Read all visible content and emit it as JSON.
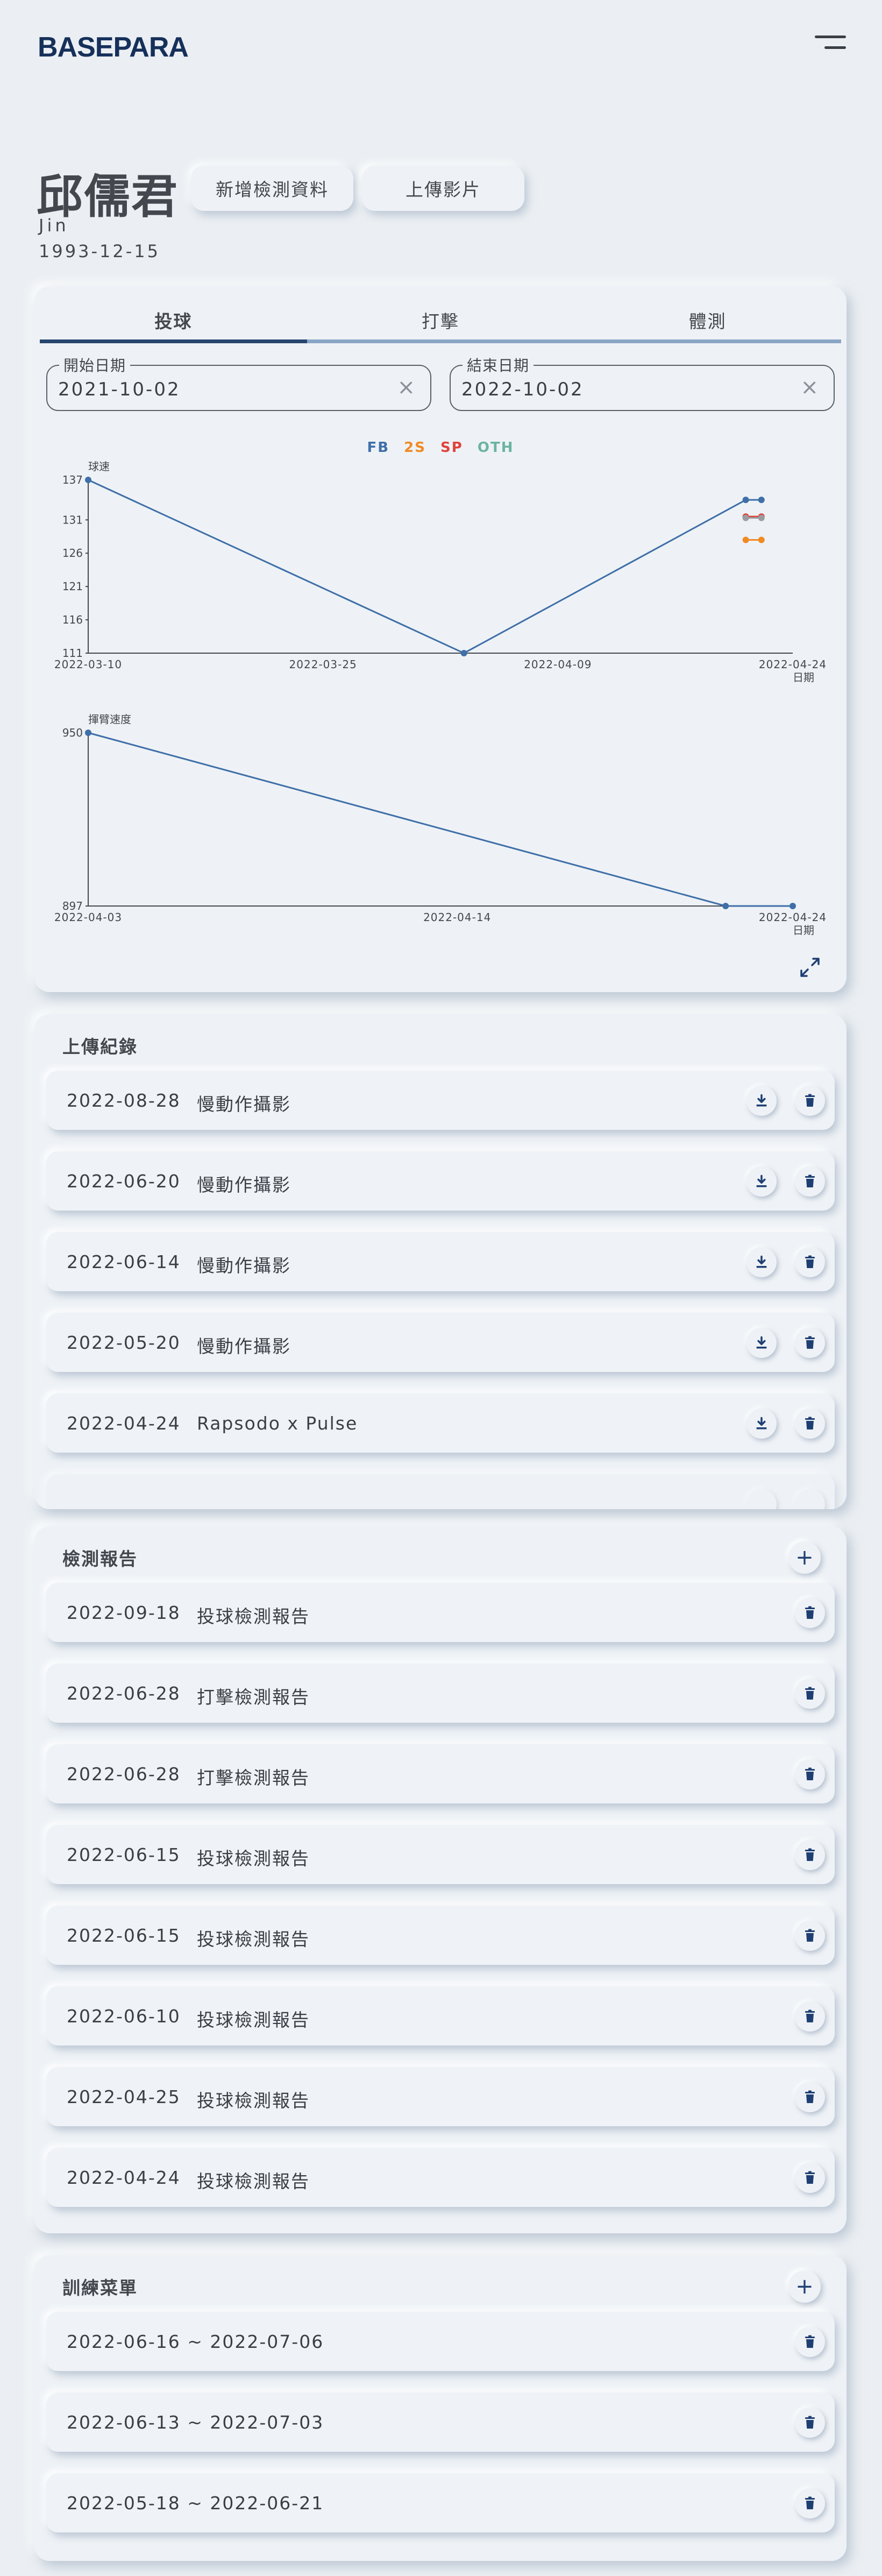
{
  "header": {
    "logo": "BASEPARA"
  },
  "profile": {
    "name": "邱儒君",
    "english_name": "Jin",
    "birthdate": "1993-12-15"
  },
  "actions": {
    "add_label": "新增檢測資料",
    "upload_label": "上傳影片"
  },
  "stats": {
    "tabs": [
      {
        "label": "投球",
        "active": true
      },
      {
        "label": "打擊",
        "active": false
      },
      {
        "label": "體測",
        "active": false
      }
    ],
    "start_date": {
      "label": "開始日期",
      "value": "2021-10-02",
      "clear": "×"
    },
    "end_date": {
      "label": "結束日期",
      "value": "2022-10-02",
      "clear": "×"
    },
    "legend": [
      {
        "name": "FB",
        "color": "#3f6fa8"
      },
      {
        "name": "2S",
        "color": "#f08a24"
      },
      {
        "name": "SP",
        "color": "#e0423b"
      },
      {
        "name": "OTH",
        "color": "#6bb3a3"
      }
    ]
  },
  "chart_data": [
    {
      "type": "line",
      "ylabel": "球速",
      "xlabel": "日期",
      "x_ticks": [
        "2022-03-10",
        "2022-03-25",
        "2022-04-09",
        "2022-04-24"
      ],
      "y_ticks": [
        111,
        116,
        121,
        126,
        131,
        137
      ],
      "ylim": [
        111,
        137
      ],
      "xlim": [
        "2022-03-10",
        "2022-04-24"
      ],
      "series": [
        {
          "name": "FB",
          "color": "#3f6fa8",
          "points": [
            [
              "2022-03-10",
              137
            ],
            [
              "2022-04-03",
              111
            ],
            [
              "2022-04-21",
              134
            ],
            [
              "2022-04-22",
              134
            ]
          ]
        },
        {
          "name": "2S",
          "color": "#f08a24",
          "points": [
            [
              "2022-04-21",
              128
            ],
            [
              "2022-04-22",
              128
            ]
          ]
        },
        {
          "name": "SP",
          "color": "#e0423b",
          "points": [
            [
              "2022-04-21",
              131.5
            ],
            [
              "2022-04-22",
              131.5
            ]
          ]
        },
        {
          "name": "OTH",
          "color": "#9a9ca0",
          "points": [
            [
              "2022-04-21",
              131.3
            ],
            [
              "2022-04-22",
              131.3
            ]
          ]
        }
      ]
    },
    {
      "type": "line",
      "ylabel": "揮臂速度",
      "xlabel": "日期",
      "x_ticks": [
        "2022-04-03",
        "2022-04-14",
        "2022-04-24"
      ],
      "y_ticks": [
        897,
        950
      ],
      "ylim": [
        897,
        950
      ],
      "xlim": [
        "2022-04-03",
        "2022-04-24"
      ],
      "series": [
        {
          "name": "FB",
          "color": "#3f6fa8",
          "points": [
            [
              "2022-04-03",
              950
            ],
            [
              "2022-04-22",
              897
            ],
            [
              "2022-04-24",
              897
            ]
          ]
        }
      ]
    }
  ],
  "uploads": {
    "title": "上傳紀錄",
    "items": [
      {
        "date": "2022-08-28",
        "label": "慢動作攝影"
      },
      {
        "date": "2022-06-20",
        "label": "慢動作攝影"
      },
      {
        "date": "2022-06-14",
        "label": "慢動作攝影"
      },
      {
        "date": "2022-05-20",
        "label": "慢動作攝影"
      },
      {
        "date": "2022-04-24",
        "label": "Rapsodo x Pulse"
      }
    ]
  },
  "reports": {
    "title": "檢測報告",
    "add": "+",
    "items": [
      {
        "date": "2022-09-18",
        "label": "投球檢測報告"
      },
      {
        "date": "2022-06-28",
        "label": "打擊檢測報告"
      },
      {
        "date": "2022-06-28",
        "label": "打擊檢測報告"
      },
      {
        "date": "2022-06-15",
        "label": "投球檢測報告"
      },
      {
        "date": "2022-06-15",
        "label": "投球檢測報告"
      },
      {
        "date": "2022-06-10",
        "label": "投球檢測報告"
      },
      {
        "date": "2022-04-25",
        "label": "投球檢測報告"
      },
      {
        "date": "2022-04-24",
        "label": "投球檢測報告"
      }
    ]
  },
  "training": {
    "title": "訓練菜單",
    "add": "+",
    "items": [
      {
        "range": "2022-06-16 ~ 2022-07-06"
      },
      {
        "range": "2022-06-13 ~ 2022-07-03"
      },
      {
        "range": "2022-05-18 ~ 2022-06-21"
      }
    ]
  },
  "colors": {
    "accent": "#27456e",
    "icon": "#1f3f73",
    "bg": "#ebeff3"
  },
  "icons": {
    "download": "download-icon",
    "delete": "trash-icon",
    "expand": "expand-icon",
    "menu": "menu-icon"
  }
}
